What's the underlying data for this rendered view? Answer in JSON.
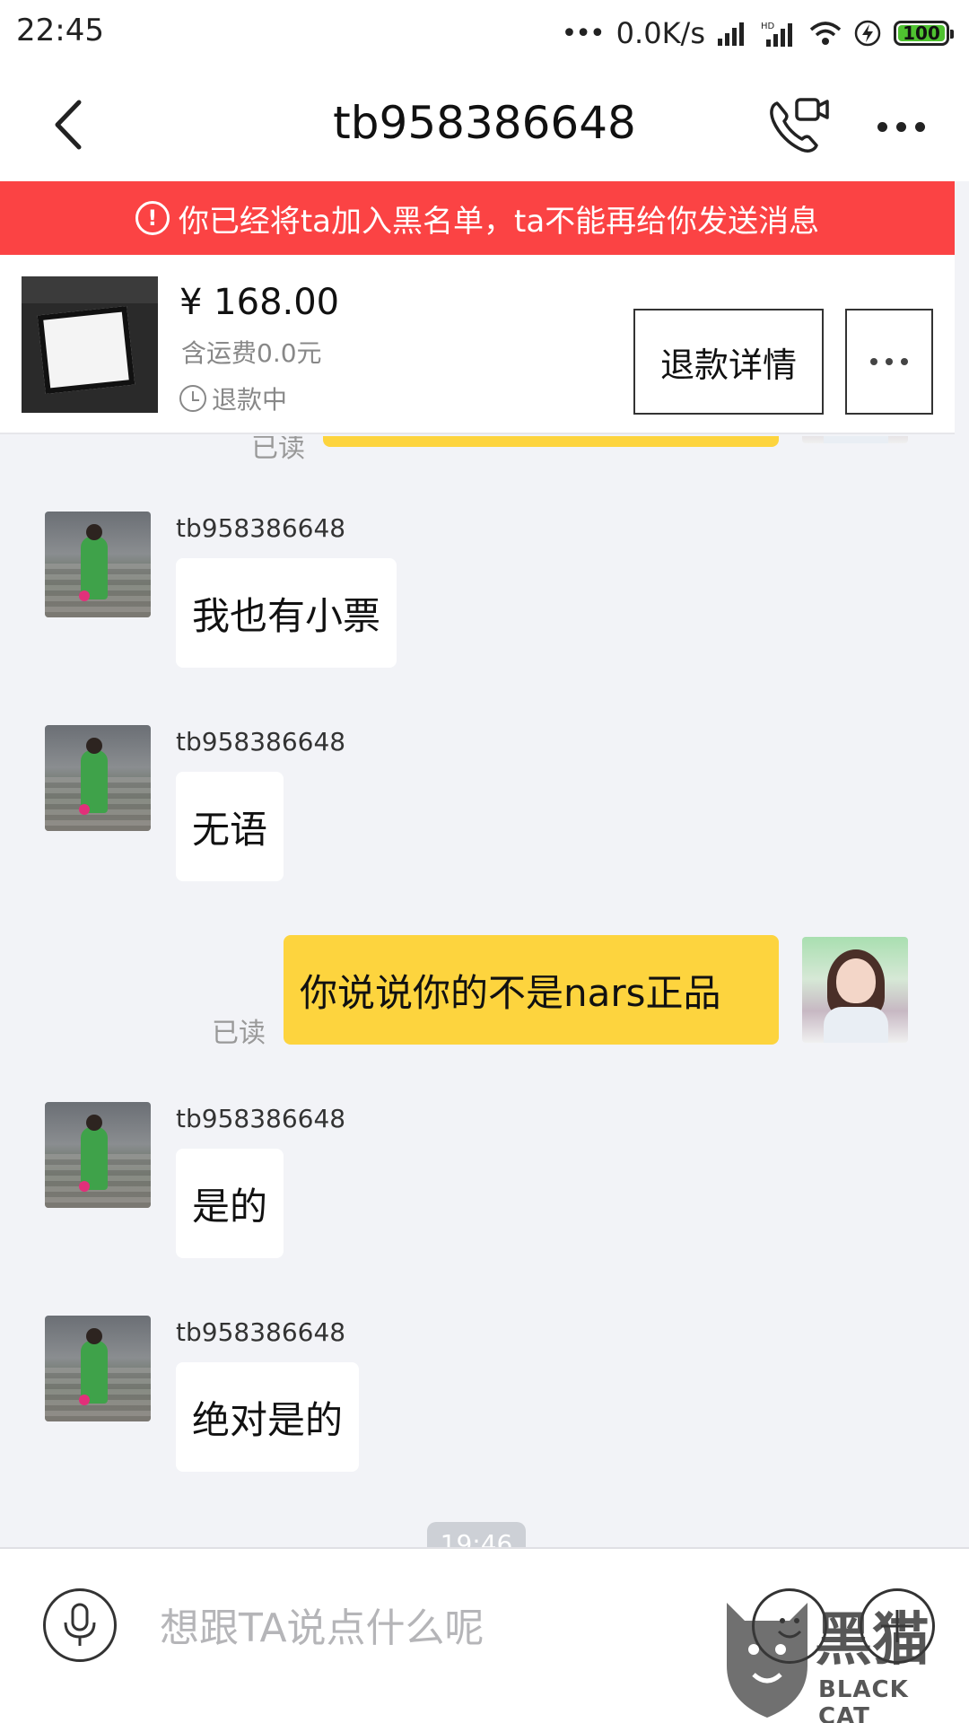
{
  "status_bar": {
    "time": "22:45",
    "network_speed": "0.0K/s",
    "battery": "100"
  },
  "header": {
    "title": "tb958386648",
    "back_icon": "chevron-left-icon",
    "call_icon": "phone-video-icon",
    "more_icon": "more-icon"
  },
  "banner": {
    "text": "你已经将ta加入黑名单，ta不能再给你发送消息",
    "color": "#fb4344"
  },
  "order": {
    "price": "¥ 168.00",
    "shipping": "含运费0.0元",
    "status": "退款中",
    "refund_button": "退款详情"
  },
  "chat": {
    "messages": [
      {
        "sender": "tb958386648",
        "text": "我也有小票"
      },
      {
        "sender": "tb958386648",
        "text": "无语"
      },
      {
        "sender": "me",
        "text": "你说说你的不是nars正品",
        "read": "已读"
      },
      {
        "sender": "tb958386648",
        "text": "是的"
      },
      {
        "sender": "tb958386648",
        "text": "绝对是的"
      }
    ],
    "partial_read_label": "已读",
    "time_divider": "19:46",
    "my_bubble_color": "#fdd43e"
  },
  "input_bar": {
    "placeholder": "想跟TA说点什么呢"
  },
  "watermark": {
    "cn": "黑猫",
    "en": "BLACK CAT"
  }
}
